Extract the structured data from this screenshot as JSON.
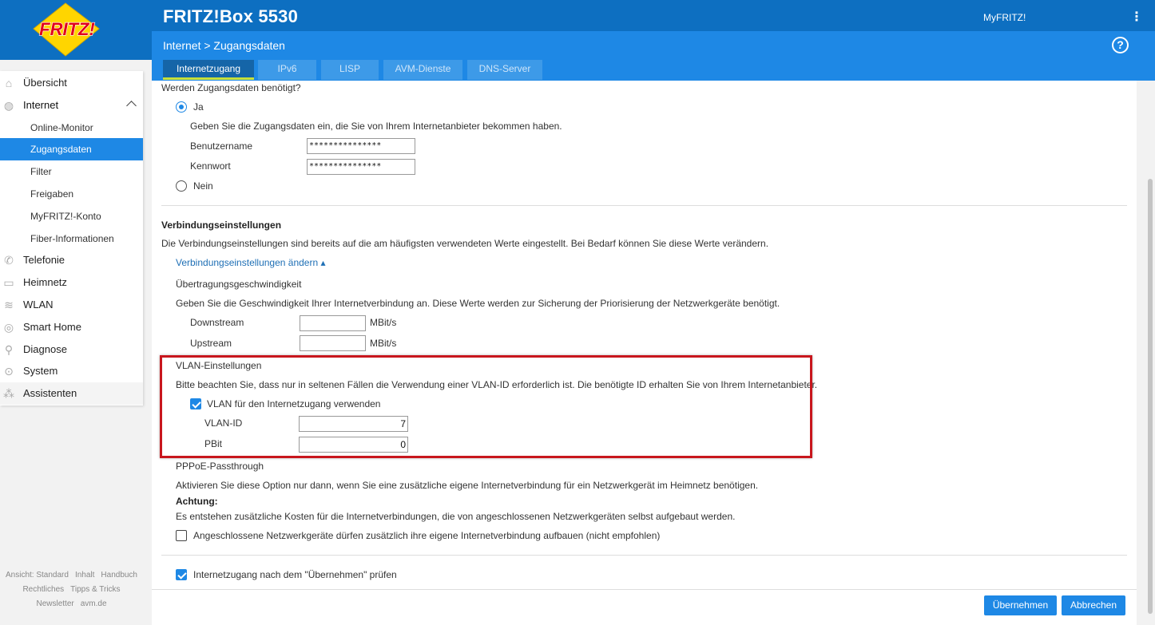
{
  "app": {
    "title": "FRITZ!Box 5530",
    "myfritz": "MyFRITZ!",
    "breadcrumb": "Internet > Zugangsdaten",
    "help": "?",
    "logo_text": "FRITZ!"
  },
  "tabs": [
    "Internetzugang",
    "IPv6",
    "LISP",
    "AVM-Dienste",
    "DNS-Server"
  ],
  "sidebar": {
    "items": [
      {
        "label": "Übersicht",
        "icon": "home-icon"
      },
      {
        "label": "Internet",
        "icon": "globe-icon"
      },
      {
        "label": "Telefonie",
        "icon": "phone-icon"
      },
      {
        "label": "Heimnetz",
        "icon": "network-icon"
      },
      {
        "label": "WLAN",
        "icon": "wifi-icon"
      },
      {
        "label": "Smart Home",
        "icon": "smarthome-icon"
      },
      {
        "label": "Diagnose",
        "icon": "diagnose-icon"
      },
      {
        "label": "System",
        "icon": "system-icon"
      },
      {
        "label": "Assistenten",
        "icon": "wizard-icon"
      }
    ],
    "subitems": [
      "Online-Monitor",
      "Zugangsdaten",
      "Filter",
      "Freigaben",
      "MyFRITZ!-Konto",
      "Fiber-Informationen"
    ]
  },
  "footer": {
    "row1": [
      "Ansicht: Standard",
      "Inhalt",
      "Handbuch"
    ],
    "row2": [
      "Rechtliches",
      "Tipps & Tricks"
    ],
    "row3": [
      "Newsletter",
      "avm.de"
    ]
  },
  "form": {
    "question": "Werden Zugangsdaten benötigt?",
    "yes": "Ja",
    "yes_hint": "Geben Sie die Zugangsdaten ein, die Sie von Ihrem Internetanbieter bekommen haben.",
    "user_label": "Benutzername",
    "user_value": "***************",
    "pass_label": "Kennwort",
    "pass_value": "***************",
    "no": "Nein",
    "conn_title": "Verbindungseinstellungen",
    "conn_desc": "Die Verbindungseinstellungen sind bereits auf die am häufigsten verwendeten Werte eingestellt. Bei Bedarf können Sie diese Werte verändern.",
    "conn_link": "Verbindungseinstellungen ändern ▴",
    "speed_title": "Übertragungsgeschwindigkeit",
    "speed_desc": "Geben Sie die Geschwindigkeit Ihrer Internetverbindung an. Diese Werte werden zur Sicherung der Priorisierung der Netzwerkgeräte benötigt.",
    "down_label": "Downstream",
    "up_label": "Upstream",
    "unit": "MBit/s",
    "vlan_title": "VLAN-Einstellungen",
    "vlan_desc": "Bitte beachten Sie, dass nur in seltenen Fällen die Verwendung einer VLAN-ID erforderlich ist. Die benötigte ID erhalten Sie von Ihrem Internetanbieter.",
    "vlan_check": "VLAN für den Internetzugang verwenden",
    "vlan_id_label": "VLAN-ID",
    "vlan_id_value": "7",
    "pbit_label": "PBit",
    "pbit_value": "0",
    "pppoe_title": "PPPoE-Passthrough",
    "pppoe_desc": "Aktivieren Sie diese Option nur dann, wenn Sie eine zusätzliche eigene Internetverbindung für ein Netzwerkgerät im Heimnetz benötigen.",
    "warn_label": "Achtung:",
    "warn_text": "Es entstehen zusätzliche Kosten für die Internetverbindungen, die von angeschlossenen Netzwerkgeräten selbst aufgebaut werden.",
    "pppoe_check": "Angeschlossene Netzwerkgeräte dürfen zusätzlich ihre eigene Internetverbindung aufbauen (nicht empfohlen)",
    "test_check": "Internetzugang nach dem \"Übernehmen\" prüfen"
  },
  "buttons": {
    "apply": "Übernehmen",
    "cancel": "Abbrechen"
  },
  "colors": {
    "header": "#0d6fc1",
    "accent": "#1e88e5",
    "highlight": "#c8161d"
  }
}
